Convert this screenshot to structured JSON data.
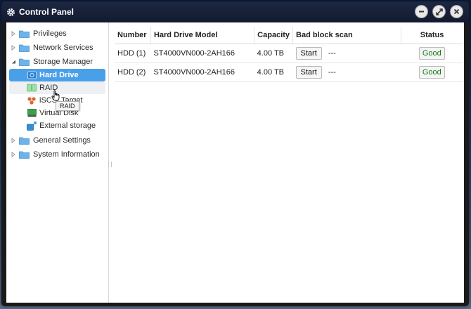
{
  "window": {
    "title": "Control Panel"
  },
  "sidebar": {
    "items": [
      {
        "label": "Privileges",
        "expanded": false
      },
      {
        "label": "Network Services",
        "expanded": false
      },
      {
        "label": "Storage Manager",
        "expanded": true,
        "children": [
          {
            "label": "Hard Drive",
            "icon": "hard-drive-icon",
            "selected": true
          },
          {
            "label": "RAID",
            "icon": "raid-icon",
            "hover": true
          },
          {
            "label": "iSCSI Target",
            "icon": "iscsi-icon"
          },
          {
            "label": "Virtual Disk",
            "icon": "virtual-disk-icon"
          },
          {
            "label": "External storage",
            "icon": "external-storage-icon"
          }
        ]
      },
      {
        "label": "General Settings",
        "expanded": false
      },
      {
        "label": "System Information",
        "expanded": false
      }
    ],
    "tooltip": "RAID"
  },
  "table": {
    "headers": {
      "number": "Number",
      "model": "Hard Drive Model",
      "capacity": "Capacity",
      "scan": "Bad block scan",
      "status": "Status"
    },
    "rows": [
      {
        "number": "HDD (1)",
        "model": "ST4000VN000-2AH166",
        "capacity": "4.00 TB",
        "scan_button": "Start",
        "scan_value": "---",
        "status": "Good"
      },
      {
        "number": "HDD (2)",
        "model": "ST4000VN000-2AH166",
        "capacity": "4.00 TB",
        "scan_button": "Start",
        "scan_value": "---",
        "status": "Good"
      }
    ]
  },
  "colors": {
    "selected_bg": "#4aa0e8",
    "status_good": "#137a13",
    "folder": "#6db3ea"
  }
}
